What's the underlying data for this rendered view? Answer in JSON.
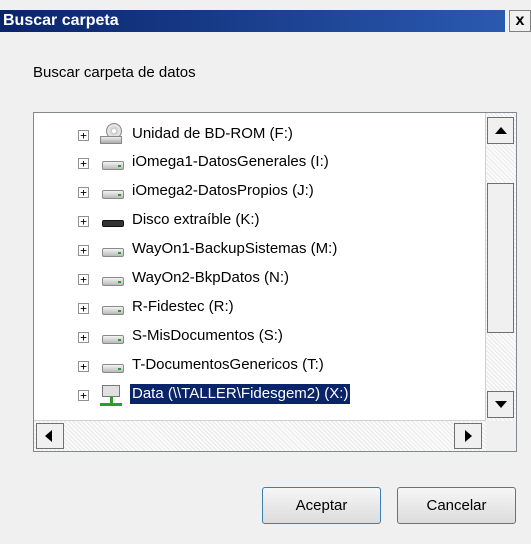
{
  "window": {
    "title": "Buscar carpeta",
    "close_label": "x"
  },
  "prompt": "Buscar carpeta de datos",
  "tree": {
    "items": [
      {
        "label": "Unidad de BD-ROM (F:)",
        "icon": "cdrom-drive-icon",
        "expander": "+",
        "selected": false
      },
      {
        "label": "iOmega1-DatosGenerales (I:)",
        "icon": "hard-drive-icon",
        "expander": "+",
        "selected": false
      },
      {
        "label": "iOmega2-DatosPropios (J:)",
        "icon": "hard-drive-icon",
        "expander": "+",
        "selected": false
      },
      {
        "label": "Disco extraíble (K:)",
        "icon": "removable-drive-icon",
        "expander": "+",
        "selected": false
      },
      {
        "label": "WayOn1-BackupSistemas (M:)",
        "icon": "hard-drive-icon",
        "expander": "+",
        "selected": false
      },
      {
        "label": "WayOn2-BkpDatos (N:)",
        "icon": "hard-drive-icon",
        "expander": "+",
        "selected": false
      },
      {
        "label": "R-Fidestec (R:)",
        "icon": "hard-drive-icon",
        "expander": "+",
        "selected": false
      },
      {
        "label": "S-MisDocumentos (S:)",
        "icon": "hard-drive-icon",
        "expander": "+",
        "selected": false
      },
      {
        "label": "T-DocumentosGenericos (T:)",
        "icon": "hard-drive-icon",
        "expander": "+",
        "selected": false
      },
      {
        "label": "Data (\\\\TALLER\\Fidesgem2) (X:)",
        "icon": "network-drive-icon",
        "expander": "+",
        "selected": true
      }
    ]
  },
  "buttons": {
    "ok": "Aceptar",
    "cancel": "Cancelar"
  }
}
